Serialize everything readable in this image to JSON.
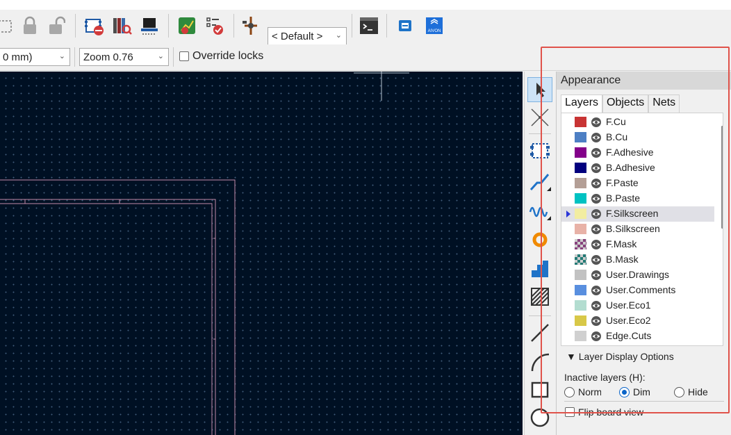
{
  "toolbar": {
    "track_width_select": "0 mm)",
    "zoom_select": "Zoom 0.76",
    "override_locks_label": "Override locks",
    "preset_select": "< Default >",
    "aivon_label": "AIVON"
  },
  "appearance": {
    "title": "Appearance",
    "tabs": [
      "Layers",
      "Objects",
      "Nets"
    ],
    "layers": [
      {
        "name": "F.Cu",
        "color": "#c83434"
      },
      {
        "name": "B.Cu",
        "color": "#4d7fc4"
      },
      {
        "name": "F.Adhesive",
        "color": "#84008a"
      },
      {
        "name": "B.Adhesive",
        "color": "#02007e"
      },
      {
        "name": "F.Paste",
        "color": "#b49f96"
      },
      {
        "name": "B.Paste",
        "color": "#00c2c2"
      },
      {
        "name": "F.Silkscreen",
        "color": "#f2eda1"
      },
      {
        "name": "B.Silkscreen",
        "color": "#e8b2a7"
      },
      {
        "name": "F.Mask",
        "color": "#7a2e6e"
      },
      {
        "name": "B.Mask",
        "color": "#0a6b66"
      },
      {
        "name": "User.Drawings",
        "color": "#c2c2c2"
      },
      {
        "name": "User.Comments",
        "color": "#598fdf"
      },
      {
        "name": "User.Eco1",
        "color": "#b3ddd0"
      },
      {
        "name": "User.Eco2",
        "color": "#d8c848"
      },
      {
        "name": "Edge.Cuts",
        "color": "#d0d0d0"
      }
    ],
    "selected_layer": "F.Silkscreen",
    "layer_display_options": "Layer Display Options",
    "inactive_layers_label": "Inactive layers (H):",
    "inactive_options": [
      "Norm",
      "Dim",
      "Hide"
    ],
    "inactive_selected": "Dim",
    "flip_board_view": "Flip board view"
  }
}
